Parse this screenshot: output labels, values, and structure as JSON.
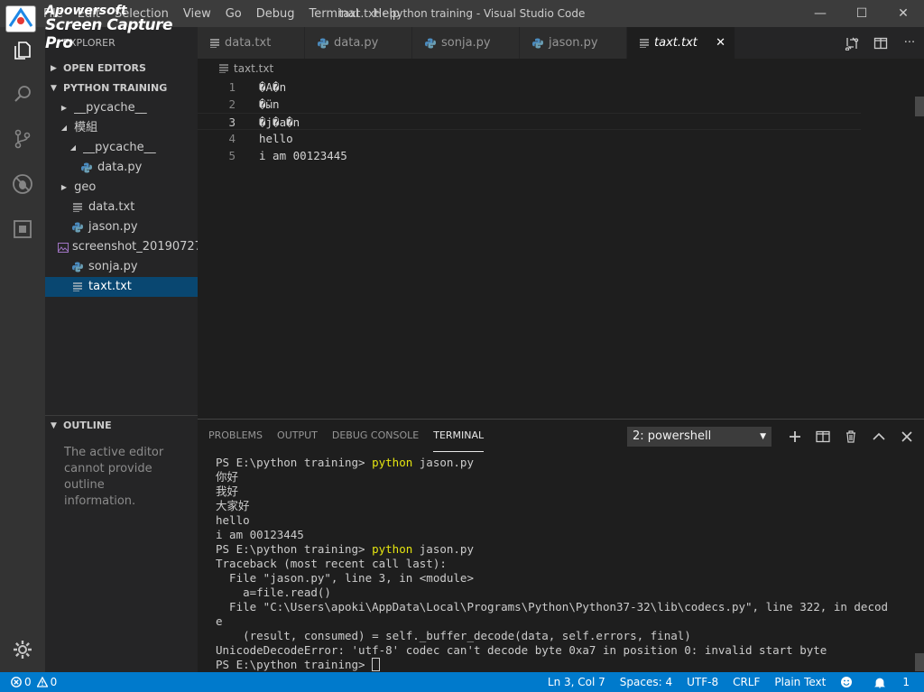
{
  "window": {
    "title": "taxt.txt - python training - Visual Studio Code",
    "menu": [
      "File",
      "Edit",
      "Selection",
      "View",
      "Go",
      "Debug",
      "Terminal",
      "Help"
    ],
    "controls": {
      "minimize": "—",
      "maximize": "☐",
      "close": "✕"
    }
  },
  "watermark": {
    "line1": "Apowersoft",
    "line2": "Screen Capture Pro"
  },
  "sidebar": {
    "title": "EXPLORER",
    "open_editors": "OPEN EDITORS",
    "workspace": "PYTHON TRAINING",
    "tree": [
      {
        "label": "__pycache__",
        "depth": 1,
        "kind": "folder-collapsed"
      },
      {
        "label": "模組",
        "depth": 1,
        "kind": "folder-expanded"
      },
      {
        "label": "__pycache__",
        "depth": 2,
        "kind": "folder-expanded"
      },
      {
        "label": "data.py",
        "depth": 2,
        "kind": "python"
      },
      {
        "label": "geo",
        "depth": 1,
        "kind": "folder-collapsed"
      },
      {
        "label": "data.txt",
        "depth": 1,
        "kind": "text"
      },
      {
        "label": "jason.py",
        "depth": 1,
        "kind": "python"
      },
      {
        "label": "screenshot_20190727...",
        "depth": 1,
        "kind": "image"
      },
      {
        "label": "sonja.py",
        "depth": 1,
        "kind": "python"
      },
      {
        "label": "taxt.txt",
        "depth": 1,
        "kind": "text",
        "selected": true
      }
    ],
    "outline_title": "OUTLINE",
    "outline_message": "The active editor cannot provide outline information."
  },
  "tabs": [
    {
      "label": "data.txt",
      "kind": "text"
    },
    {
      "label": "data.py",
      "kind": "python"
    },
    {
      "label": "sonja.py",
      "kind": "python"
    },
    {
      "label": "jason.py",
      "kind": "python"
    },
    {
      "label": "taxt.txt",
      "kind": "text",
      "active": true,
      "close": "✕"
    }
  ],
  "breadcrumb": "taxt.txt",
  "editor": {
    "lines": [
      {
        "num": "1",
        "text": "�A�n"
      },
      {
        "num": "2",
        "text": "�ӹn"
      },
      {
        "num": "3",
        "text": "�j�a�n",
        "current": true
      },
      {
        "num": "4",
        "text": "hello"
      },
      {
        "num": "5",
        "text": "i am 00123445"
      }
    ]
  },
  "panel": {
    "tabs": [
      "PROBLEMS",
      "OUTPUT",
      "DEBUG CONSOLE",
      "TERMINAL"
    ],
    "active_tab": "TERMINAL",
    "terminal_select": "2: powershell",
    "terminal_lines": [
      {
        "prompt": "PS E:\\python training> ",
        "cmd": "python",
        "args": " jason.py"
      },
      {
        "text": "你好"
      },
      {
        "text": "我好"
      },
      {
        "text": "大家好"
      },
      {
        "text": "hello"
      },
      {
        "text": "i am 00123445"
      },
      {
        "prompt": "PS E:\\python training> ",
        "cmd": "python",
        "args": " jason.py"
      },
      {
        "text": "Traceback (most recent call last):"
      },
      {
        "text": "  File \"jason.py\", line 3, in <module>"
      },
      {
        "text": "    a=file.read()"
      },
      {
        "text": "  File \"C:\\Users\\apoki\\AppData\\Local\\Programs\\Python\\Python37-32\\lib\\codecs.py\", line 322, in decod"
      },
      {
        "text": "e"
      },
      {
        "text": "    (result, consumed) = self._buffer_decode(data, self.errors, final)"
      },
      {
        "text": "UnicodeDecodeError: 'utf-8' codec can't decode byte 0xa7 in position 0: invalid start byte"
      },
      {
        "prompt": "PS E:\\python training> ",
        "cursor": true
      }
    ]
  },
  "status": {
    "errors": "0",
    "warnings": "0",
    "position": "Ln 3, Col 7",
    "spaces": "Spaces: 4",
    "encoding": "UTF-8",
    "eol": "CRLF",
    "language": "Plain Text",
    "notifications": "1"
  },
  "colors": {
    "accent": "#007acc",
    "selection": "#094771",
    "terminal_command": "#e5e510",
    "python_icon": "#4b8bbe"
  }
}
